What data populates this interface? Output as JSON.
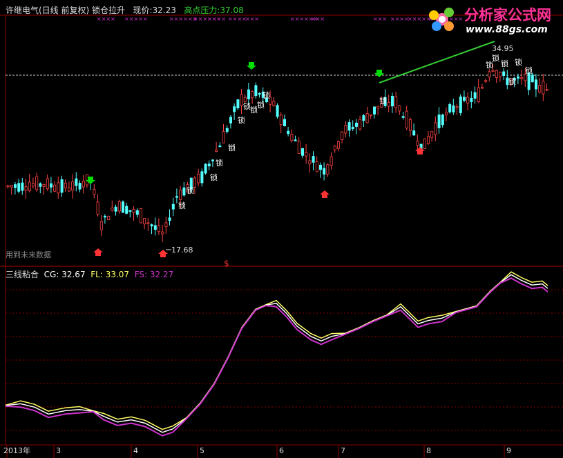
{
  "header": {
    "title": "许继电气(日线 前复权)",
    "indicator_name": "锁仓拉升",
    "price_label": "现价:",
    "price_value": "32.23",
    "pressure_label": "高点压力:",
    "pressure_value": "37.08"
  },
  "logo": {
    "text": "分析家公式网",
    "url": "www.88gs.com"
  },
  "main_chart": {
    "high_marker": "34.95",
    "low_marker": "17.68",
    "lock_label": "锁",
    "note": "用到未来数据",
    "s_marker": "$"
  },
  "indicator": {
    "name": "三线粘合",
    "cg_label": "CG:",
    "cg_value": "32.67",
    "fl_label": "FL:",
    "fl_value": "33.07",
    "fs_label": "FS:",
    "fs_value": "32.27"
  },
  "xaxis": {
    "labels": [
      "2013年",
      "3",
      "4",
      "5",
      "6",
      "7",
      "8",
      "9"
    ]
  },
  "colors": {
    "up": "#ff4444",
    "down": "#54ffff",
    "cg": "#ffffff",
    "fl": "#ffff66",
    "fs": "#cc33cc",
    "trend": "#33cc33",
    "signal_down": "#00dd00",
    "signal_up": "#ff3333",
    "grid": "#8b0000"
  },
  "chart_data": [
    {
      "type": "candlestick",
      "title": "许继电气(日线 前复权) 锁仓拉升",
      "x": [
        "2013-02",
        "2013-03",
        "2013-04",
        "2013-05",
        "2013-06",
        "2013-07",
        "2013-08",
        "2013-09"
      ],
      "y": [
        23.3,
        23.4,
        20.1,
        27.5,
        31.0,
        28.5,
        31.8,
        32.2
      ],
      "annotations": {
        "high": 34.95,
        "low": 17.68,
        "pressure": 37.08
      }
    },
    {
      "type": "line",
      "title": "三线粘合",
      "x": [
        "2013-02",
        "2013-03",
        "2013-04",
        "2013-05",
        "2013-06",
        "2013-07",
        "2013-08",
        "2013-09"
      ],
      "series": [
        {
          "name": "CG",
          "values": [
            22.6,
            22.3,
            20.5,
            26.5,
            31.5,
            28.7,
            30.5,
            32.67
          ]
        },
        {
          "name": "FL",
          "values": [
            22.7,
            22.4,
            20.8,
            26.4,
            31.7,
            29.0,
            30.8,
            33.07
          ]
        },
        {
          "name": "FS",
          "values": [
            22.5,
            22.1,
            20.2,
            26.6,
            31.3,
            28.5,
            30.2,
            32.27
          ]
        }
      ]
    }
  ]
}
